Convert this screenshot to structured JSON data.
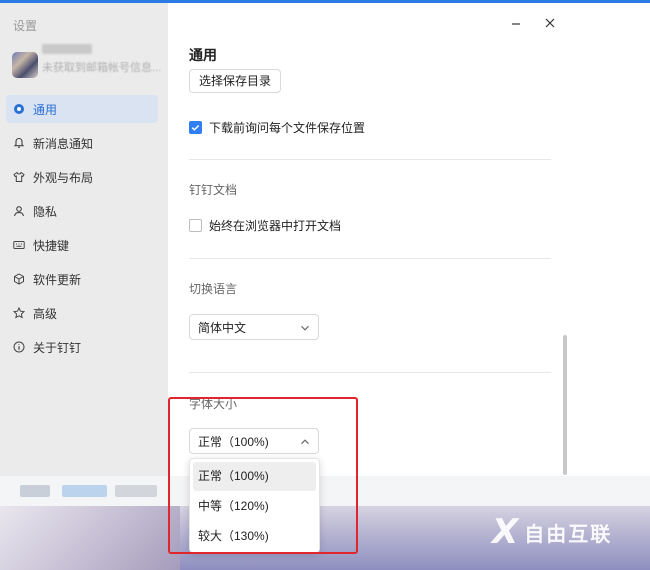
{
  "window": {
    "title": "设置"
  },
  "profile": {
    "subtitle": "未获取到邮箱帐号信息..."
  },
  "sidebar": {
    "items": [
      {
        "label": "通用",
        "icon": "gear-icon",
        "active": true
      },
      {
        "label": "新消息通知",
        "icon": "bell-icon",
        "active": false
      },
      {
        "label": "外观与布局",
        "icon": "shirt-icon",
        "active": false
      },
      {
        "label": "隐私",
        "icon": "user-icon",
        "active": false
      },
      {
        "label": "快捷键",
        "icon": "keyboard-icon",
        "active": false
      },
      {
        "label": "软件更新",
        "icon": "cube-icon",
        "active": false
      },
      {
        "label": "高级",
        "icon": "star-icon",
        "active": false
      },
      {
        "label": "关于钉钉",
        "icon": "info-icon",
        "active": false
      }
    ]
  },
  "general": {
    "title": "通用",
    "choose_dir_button": "选择保存目录",
    "ask_location_checkbox": {
      "label": "下载前询问每个文件保存位置",
      "checked": true
    }
  },
  "docs": {
    "title": "钉钉文档",
    "open_in_browser_checkbox": {
      "label": "始终在浏览器中打开文档",
      "checked": false
    }
  },
  "language": {
    "title": "切换语言",
    "selected": "简体中文"
  },
  "font_size": {
    "title": "字体大小",
    "selected": "正常（100%)",
    "options": [
      "正常（100%)",
      "中等（120%)",
      "较大（130%)"
    ]
  },
  "watermark": {
    "text": "自由互联"
  },
  "colors": {
    "accent": "#2f7ef4",
    "highlight": "#e0262a",
    "sidebar_bg": "#ebebeb"
  }
}
